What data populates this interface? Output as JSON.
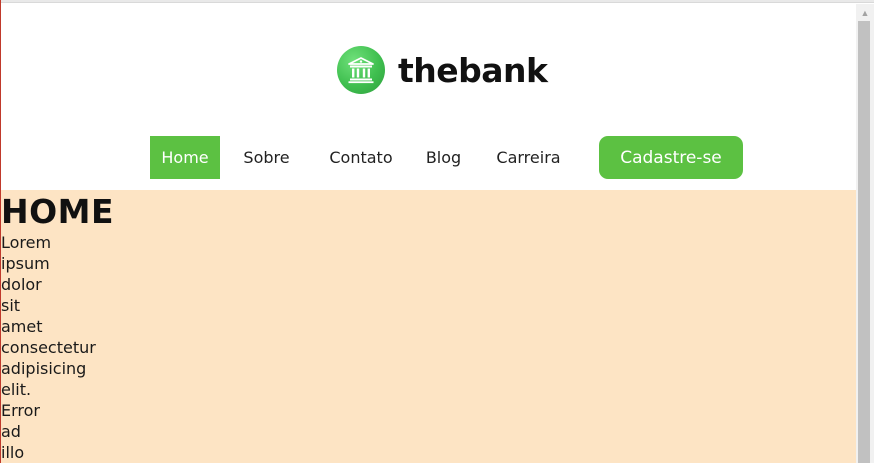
{
  "brand": {
    "name": "thebank",
    "logo_icon": "bank-building-icon",
    "accent_color": "#5cc142"
  },
  "nav": {
    "items": [
      {
        "label": "Home",
        "active": true
      },
      {
        "label": "Sobre",
        "active": false
      },
      {
        "label": "Contato",
        "active": false
      },
      {
        "label": "Blog",
        "active": false
      },
      {
        "label": "Carreira",
        "active": false
      }
    ],
    "cta_label": "Cadastre-se"
  },
  "content": {
    "title": "HOME",
    "background_color": "#fde4c4",
    "words": [
      "Lorem",
      "ipsum",
      "dolor",
      "sit",
      "amet",
      "consectetur",
      "adipisicing",
      "elit.",
      "Error",
      "ad",
      "illo"
    ]
  }
}
